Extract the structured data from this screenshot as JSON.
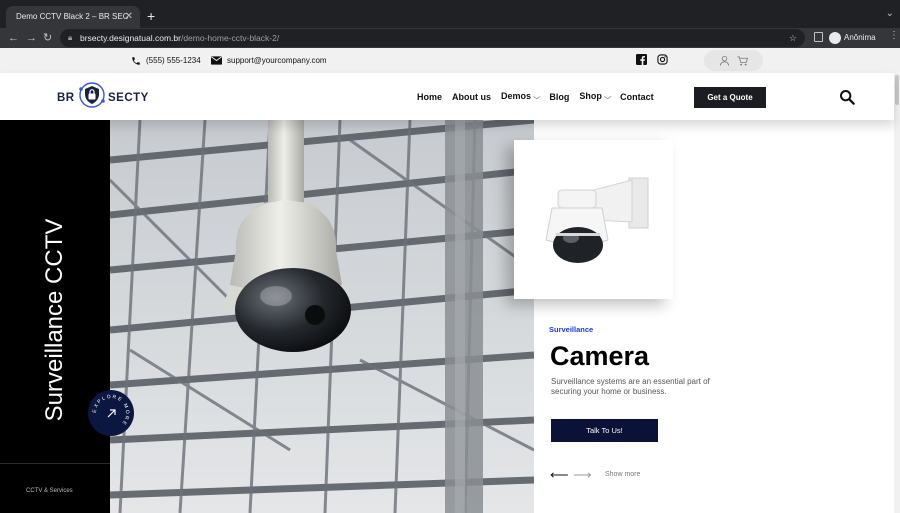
{
  "browser": {
    "tab_title": "Demo CCTV Black 2 – BR SEC",
    "tab_close": "✕",
    "new_tab": "+",
    "back": "←",
    "forward": "→",
    "reload": "↻",
    "url_domain": "brsecty.designatual.com.br",
    "url_path": "/demo-home-cctv-black-2/",
    "profile_name": "Anônima"
  },
  "topbar": {
    "phone": "(555) 555-1234",
    "email": "support@yourcompany.com"
  },
  "header": {
    "logo_left": "BR",
    "logo_right": "SECTY",
    "nav": [
      {
        "label": "Home"
      },
      {
        "label": "About us"
      },
      {
        "label": "Demos",
        "has_dropdown": true
      },
      {
        "label": "Blog"
      },
      {
        "label": "Shop",
        "has_dropdown": true
      },
      {
        "label": "Contact"
      }
    ],
    "dropdown_caret": "⌵",
    "cta": "Get a Quote"
  },
  "hero": {
    "vertical_title": "Surveillance CCTV",
    "explore_text": "EXPLORE MORE",
    "left_footer": "CCTV & Services",
    "eyebrow": "Surveillance",
    "headline": "Camera",
    "description": "Surveillance systems are an essential part of securing your home or business.",
    "button": "Talk To Us!",
    "prev_arrow": "⟵",
    "next_arrow": "⟶",
    "show_more": "Show more"
  },
  "icons": {
    "phone": "phone-icon",
    "mail": "mail-icon",
    "facebook": "facebook-icon",
    "instagram": "instagram-icon",
    "user": "user-icon",
    "cart": "cart-icon",
    "search": "search-icon"
  },
  "colors": {
    "accent_blue": "#1b3bd6",
    "navy": "#0b1238",
    "dark_button": "#1b1d22"
  }
}
